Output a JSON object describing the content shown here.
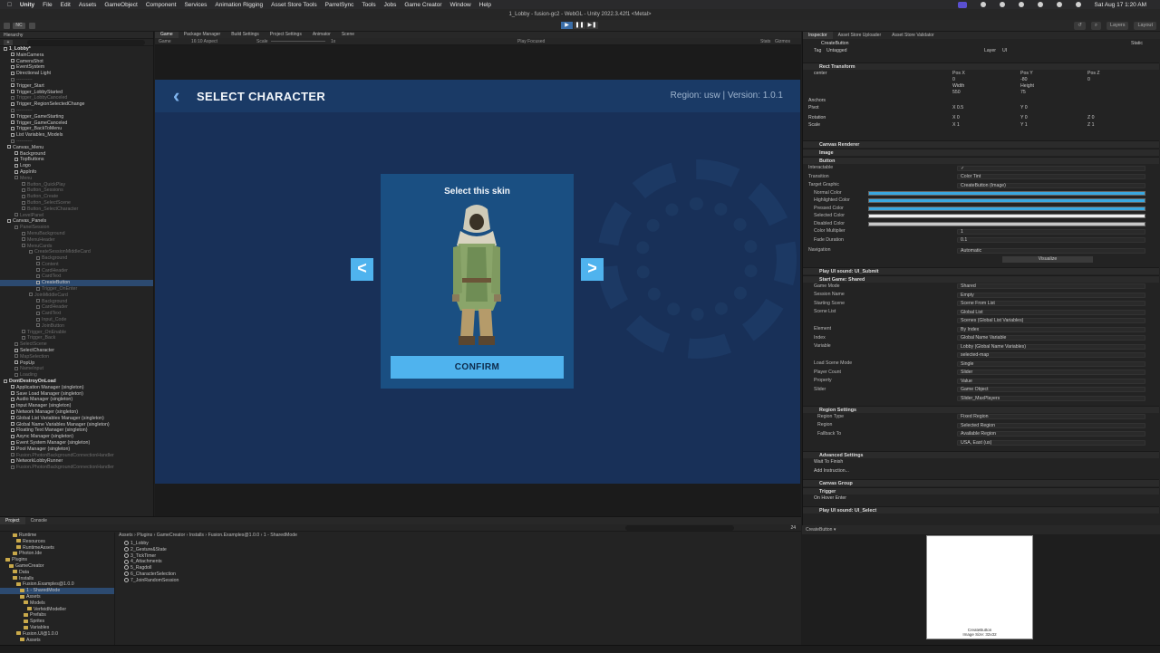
{
  "menubar": {
    "apple": "",
    "app": "Unity",
    "items": [
      "File",
      "Edit",
      "Assets",
      "GameObject",
      "Component",
      "Services",
      "Animation Rigging",
      "Asset Store Tools",
      "ParrelSync",
      "Tools",
      "Jobs",
      "Game Creator",
      "Window",
      "Help"
    ],
    "clock": "Sat Aug 17  1:20 AM"
  },
  "window_title": "1_Lobby - fusion-gc2 - WebGL - Unity 2022.3.42f1 <Metal>",
  "toolbar": {
    "account": "NC",
    "layers": "Layers",
    "layout": "Layout"
  },
  "hierarchy": {
    "tab": "Hierarchy",
    "rows": [
      {
        "t": "1_Lobby*",
        "d": 0,
        "s": "scene"
      },
      {
        "t": "MainCamera",
        "d": 2
      },
      {
        "t": "CameraShot",
        "d": 2
      },
      {
        "t": "EventSystem",
        "d": 2
      },
      {
        "t": "Directional Light",
        "d": 2
      },
      {
        "t": "----------",
        "d": 2,
        "s": "dim"
      },
      {
        "t": "Trigger_Start",
        "d": 2
      },
      {
        "t": "Trigger_LobbyStarted",
        "d": 2
      },
      {
        "t": "Trigger_LobbyCanceled",
        "d": 2,
        "s": "dim"
      },
      {
        "t": "Trigger_RegionSelectedChange",
        "d": 2
      },
      {
        "t": "----------",
        "d": 2,
        "s": "dim"
      },
      {
        "t": "Trigger_GameStarting",
        "d": 2
      },
      {
        "t": "Trigger_GameCanceled",
        "d": 2
      },
      {
        "t": "Trigger_BackToMenu",
        "d": 2
      },
      {
        "t": "List Variables_Models",
        "d": 2
      },
      {
        "t": "----------",
        "d": 2,
        "s": "dim"
      },
      {
        "t": "Canvas_Menu",
        "d": 1
      },
      {
        "t": "Background",
        "d": 3
      },
      {
        "t": "TopButtons",
        "d": 3
      },
      {
        "t": "Logo",
        "d": 3
      },
      {
        "t": "AppInfo",
        "d": 3
      },
      {
        "t": "Menu",
        "d": 3,
        "s": "dim"
      },
      {
        "t": "Button_QuickPlay",
        "d": 5,
        "s": "dim"
      },
      {
        "t": "Button_Sessions",
        "d": 5,
        "s": "dim"
      },
      {
        "t": "Button_Create",
        "d": 5,
        "s": "dim"
      },
      {
        "t": "Button_SelectScene",
        "d": 5,
        "s": "dim"
      },
      {
        "t": "Button_SelectCharacter",
        "d": 5,
        "s": "dim"
      },
      {
        "t": "LevelPanel",
        "d": 3,
        "s": "dim"
      },
      {
        "t": "Canvas_Panels",
        "d": 1
      },
      {
        "t": "PanelSession",
        "d": 3,
        "s": "dim"
      },
      {
        "t": "MenuBackground",
        "d": 5,
        "s": "dim"
      },
      {
        "t": "MenuHeader",
        "d": 5,
        "s": "dim"
      },
      {
        "t": "MenuCards",
        "d": 5,
        "s": "dim"
      },
      {
        "t": "CreateSessionMiddleCard",
        "d": 7,
        "s": "dim"
      },
      {
        "t": "Background",
        "d": 9,
        "s": "dim"
      },
      {
        "t": "Content",
        "d": 9,
        "s": "dim"
      },
      {
        "t": "CardHeader",
        "d": 9,
        "s": "dim"
      },
      {
        "t": "CardText",
        "d": 9,
        "s": "dim"
      },
      {
        "t": "CreateButton",
        "d": 9,
        "s": "sel"
      },
      {
        "t": "Trigger_OnEnter",
        "d": 9,
        "s": "dim"
      },
      {
        "t": "JoinMiddleCard",
        "d": 7,
        "s": "dim"
      },
      {
        "t": "Background",
        "d": 9,
        "s": "dim"
      },
      {
        "t": "CardHeader",
        "d": 9,
        "s": "dim"
      },
      {
        "t": "CardText",
        "d": 9,
        "s": "dim"
      },
      {
        "t": "Input_Code",
        "d": 9,
        "s": "dim"
      },
      {
        "t": "JoinButton",
        "d": 9,
        "s": "dim"
      },
      {
        "t": "Trigger_OnEnable",
        "d": 5,
        "s": "dim"
      },
      {
        "t": "Trigger_Back",
        "d": 5,
        "s": "dim"
      },
      {
        "t": "SelectScene",
        "d": 3,
        "s": "dim"
      },
      {
        "t": "SelectCharacter",
        "d": 3
      },
      {
        "t": "MapSelection",
        "d": 3,
        "s": "dim"
      },
      {
        "t": "PopUp",
        "d": 3
      },
      {
        "t": "NameInput",
        "d": 3,
        "s": "dim"
      },
      {
        "t": "Loading",
        "d": 3,
        "s": "dim"
      },
      {
        "t": "DontDestroyOnLoad",
        "d": 0,
        "s": "scene"
      },
      {
        "t": "Application Manager (singleton)",
        "d": 2
      },
      {
        "t": "Save Load Manager (singleton)",
        "d": 2
      },
      {
        "t": "Audio Manager (singleton)",
        "d": 2
      },
      {
        "t": "Input Manager (singleton)",
        "d": 2
      },
      {
        "t": "Network Manager (singleton)",
        "d": 2
      },
      {
        "t": "Global List Variables Manager (singleton)",
        "d": 2
      },
      {
        "t": "Global Name Variables Manager (singleton)",
        "d": 2
      },
      {
        "t": "Floating Text Manager (singleton)",
        "d": 2
      },
      {
        "t": "Async Manager (singleton)",
        "d": 2
      },
      {
        "t": "Event System Manager (singleton)",
        "d": 2
      },
      {
        "t": "Pool Manager (singleton)",
        "d": 2
      },
      {
        "t": "Fusion.PhotonBackgroundConnectionHandler",
        "d": 2,
        "s": "dim"
      },
      {
        "t": "NetworkLobbyRunner",
        "d": 2
      },
      {
        "t": "Fusion.PhotonBackgroundConnectionHandler",
        "d": 2,
        "s": "dim"
      }
    ]
  },
  "game_view": {
    "tabs": [
      "Game",
      "Package Manager",
      "Build Settings",
      "Project Settings",
      "Animator",
      "Scene"
    ],
    "display": "Game",
    "aspect": "16:10 Aspect",
    "scale": "Scale",
    "scale_val": "1x",
    "play_focused": "Play Focused",
    "stats": "Stats",
    "gizmos": "Gizmos",
    "header_title": "SELECT CHARACTER",
    "region_info": "Region: usw  |  Version: 1.0.1",
    "card_title": "Select this skin",
    "confirm": "CONFIRM",
    "prev": "<",
    "next": ">"
  },
  "inspector": {
    "tabs": [
      "Inspector",
      "Asset Store Uploader",
      "Asset Store Validator"
    ],
    "object_name": "CreateButton",
    "static": "Static",
    "tag_label": "Tag",
    "tag": "Untagged",
    "layer_label": "Layer",
    "layer": "UI",
    "components": {
      "rect": "Rect Transform",
      "canvas_renderer": "Canvas Renderer",
      "image": "Image",
      "button": "Button",
      "canvas_group": "Canvas Group",
      "trigger": "Trigger"
    },
    "rect": {
      "anchor": "center",
      "posx_l": "Pos X",
      "posx": "0",
      "posy_l": "Pos Y",
      "posy": "-80",
      "posz_l": "Pos Z",
      "posz": "0",
      "w_l": "Width",
      "w": "550",
      "h_l": "Height",
      "h": "75",
      "anchors": "Anchors",
      "pivot": "Pivot",
      "pivot_x": "X 0.5",
      "pivot_y": "Y 0",
      "rotation": "Rotation",
      "rot_x": "X 0",
      "rot_y": "Y 0",
      "rot_z": "Z 0",
      "scale": "Scale",
      "scale_x": "X 1",
      "scale_y": "Y 1",
      "scale_z": "Z 1"
    },
    "button_fields": [
      {
        "l": "Interactable",
        "v": "✓"
      },
      {
        "l": "Transition",
        "v": "Color Tint"
      },
      {
        "l": "Target Graphic",
        "v": "CreateButton (Image)"
      }
    ],
    "color_fields": [
      "Normal Color",
      "Highlighted Color",
      "Pressed Color",
      "Selected Color",
      "Disabled Color"
    ],
    "color_multiplier": {
      "l": "Color Multiplier",
      "v": "1"
    },
    "fade": {
      "l": "Fade Duration",
      "v": "0.1"
    },
    "navigation": {
      "l": "Navigation",
      "v": "Automatic"
    },
    "visualize": "Visualize",
    "instr1": "Play UI sound: UI_Submit",
    "instr2": "Start Game: Shared",
    "game_fields": [
      {
        "l": "Game Mode",
        "v": "Shared"
      },
      {
        "l": "Session Name",
        "v": "Empty"
      },
      {
        "l": "Starting Scene",
        "v": "Scene From List"
      },
      {
        "l": "Scene List",
        "v": "Global List"
      },
      {
        "l": "",
        "v": "Scenes (Global List Variables)"
      },
      {
        "l": "Element",
        "v": "By Index"
      },
      {
        "l": "Index",
        "v": "Global Name Variable"
      },
      {
        "l": "Variable",
        "v": "Lobby (Global Name Variables)"
      },
      {
        "l": "",
        "v": "selected-map"
      },
      {
        "l": "Load Scene Mode",
        "v": "Single"
      },
      {
        "l": "Player Count",
        "v": "Slider"
      },
      {
        "l": "Property",
        "v": "Value"
      },
      {
        "l": "Slider",
        "v": "Game Object"
      },
      {
        "l": "",
        "v": "Slider_MaxPlayers"
      }
    ],
    "region_settings": "Region Settings",
    "region_fields": [
      {
        "l": "Region Type",
        "v": "Fixed Region"
      },
      {
        "l": "Region",
        "v": "Selected Region"
      },
      {
        "l": "Fallback To",
        "v": "Available Region"
      },
      {
        "l": "",
        "v": "USA, East (us)"
      }
    ],
    "advanced": "Advanced Settings",
    "wait": "Wait To Finish",
    "add_instruction": "Add Instruction...",
    "on_hover": "On Hover Enter",
    "instr3": "Play UI sound: UI_Select",
    "footer": "CreateButton ▾",
    "preview_label": "CreateButton\nImage Size: 32x32"
  },
  "project": {
    "tabs": [
      "Project",
      "Console"
    ],
    "tree": [
      {
        "t": "Runtime",
        "d": 3
      },
      {
        "t": "Resources",
        "d": 4
      },
      {
        "t": "RuntimeAssets",
        "d": 4
      },
      {
        "t": "Photon.Ide",
        "d": 3
      },
      {
        "t": "Plugins",
        "d": 1
      },
      {
        "t": "GameCreator",
        "d": 2
      },
      {
        "t": "Data",
        "d": 3
      },
      {
        "t": "Installs",
        "d": 3
      },
      {
        "t": "Fusion.Examples@1.0.0",
        "d": 4
      },
      {
        "t": "1 - SharedMode",
        "d": 5,
        "s": "sel"
      },
      {
        "t": "Assets",
        "d": 5
      },
      {
        "t": "Models",
        "d": 6
      },
      {
        "t": "VerfeidModeller",
        "d": 7
      },
      {
        "t": "Prefabs",
        "d": 6
      },
      {
        "t": "Sprites",
        "d": 6
      },
      {
        "t": "Variables",
        "d": 6
      },
      {
        "t": "Fusion.UI@1.0.0",
        "d": 4
      },
      {
        "t": "Assets",
        "d": 5
      }
    ],
    "breadcrumbs": "Assets › Plugins › GameCreator › Installs › Fusion.Examples@1.0.0 › 1 - SharedMode",
    "files": [
      "1_Lobby",
      "2_Gesture&State",
      "3_TickTimer",
      "4_Attachments",
      "5_Ragdoll",
      "6_CharacterSelection",
      "7_JoinRandomSession"
    ],
    "count": "24"
  }
}
